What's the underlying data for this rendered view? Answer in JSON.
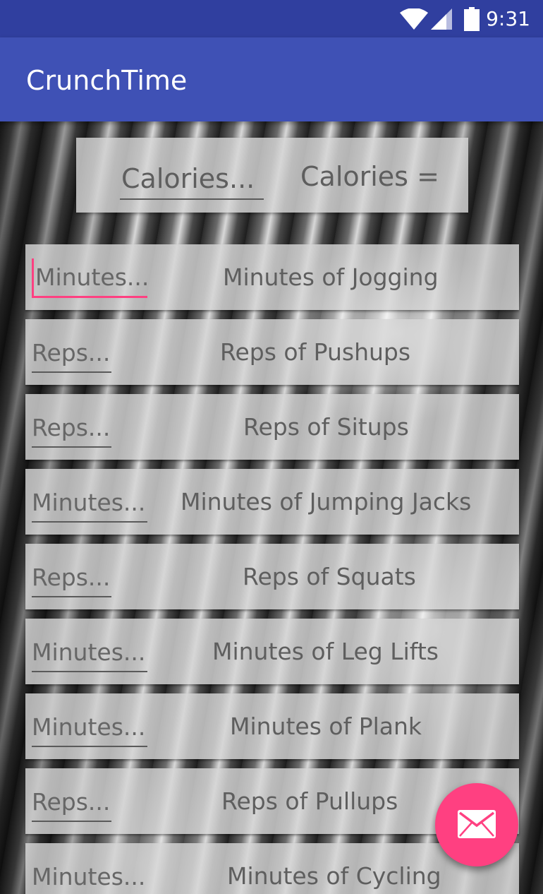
{
  "status_bar": {
    "time": "9:31",
    "icons": [
      "wifi-icon",
      "cell-signal-icon",
      "battery-icon"
    ],
    "background": "#303f9f"
  },
  "app_bar": {
    "title": "CrunchTime",
    "background": "#3f51b5"
  },
  "header": {
    "calories_placeholder": "Calories...",
    "calories_result": "Calories ="
  },
  "exercises": [
    {
      "placeholder": "Minutes...",
      "label": "Minutes of Jogging"
    },
    {
      "placeholder": "Reps...",
      "label": "Reps of Pushups"
    },
    {
      "placeholder": "Reps...",
      "label": "Reps of Situps"
    },
    {
      "placeholder": "Minutes...",
      "label": "Minutes of Jumping Jacks"
    },
    {
      "placeholder": "Reps...",
      "label": "Reps of Squats"
    },
    {
      "placeholder": "Minutes...",
      "label": "Minutes of Leg Lifts"
    },
    {
      "placeholder": "Minutes...",
      "label": "Minutes of Plank"
    },
    {
      "placeholder": "Reps...",
      "label": "Reps of Pullups"
    },
    {
      "placeholder": "Minutes...",
      "label": "Minutes of Cycling"
    }
  ],
  "fab": {
    "icon": "email-icon",
    "color": "#ff4081"
  },
  "accent_color": "#ff4081"
}
